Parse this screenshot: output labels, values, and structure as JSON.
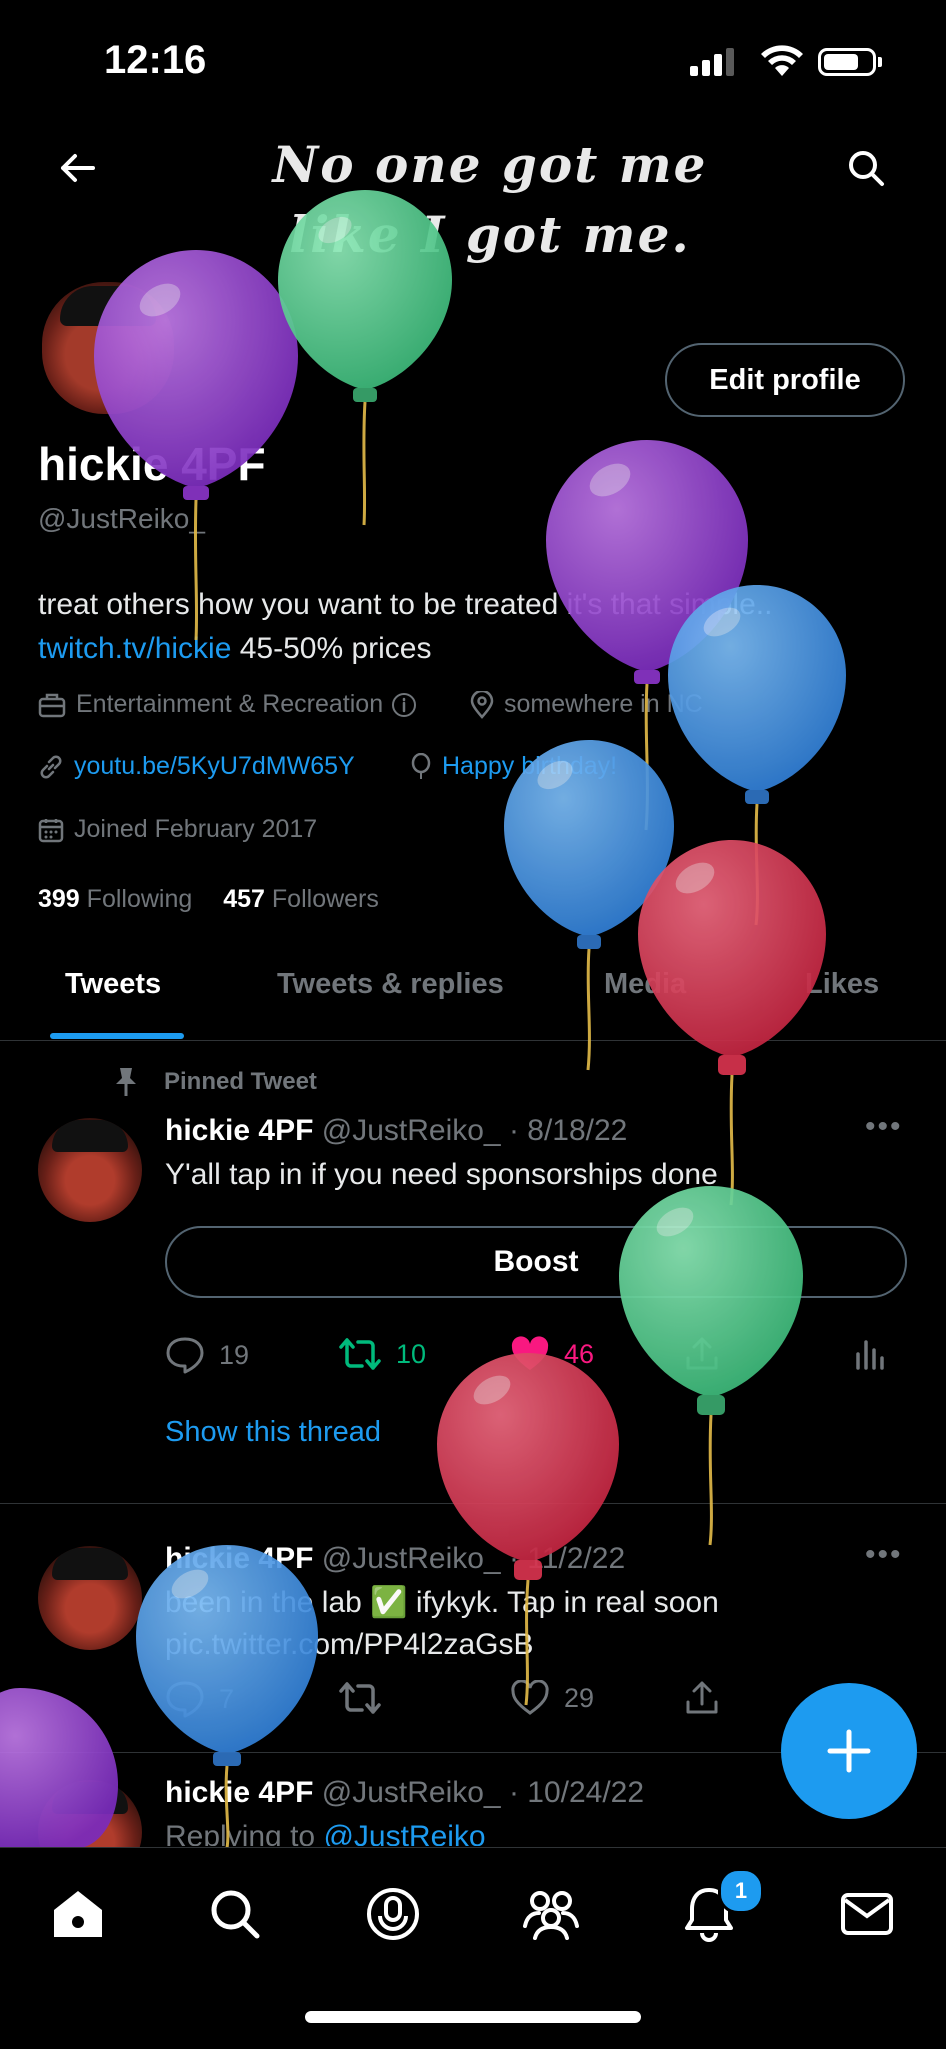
{
  "status": {
    "time": "12:16"
  },
  "banner": {
    "text": "No one got me\nlike I got me."
  },
  "profile": {
    "edit_label": "Edit profile",
    "name": "hickie 4PF",
    "handle": "@JustReiko_",
    "bio_line1": "treat others how you want to be treated it's that simple..",
    "bio_link": "twitch.tv/hickie",
    "bio_rest": " 45-50% prices",
    "category": "Entertainment & Recreation",
    "location": "somewhere in NC",
    "website": "youtu.be/5KyU7dMW65Y",
    "birthday": "Happy birthday!",
    "joined": "Joined February 2017",
    "following_count": "399",
    "following_label": "Following",
    "followers_count": "457",
    "followers_label": "Followers"
  },
  "tabs": [
    {
      "label": "Tweets"
    },
    {
      "label": "Tweets & replies"
    },
    {
      "label": "Media"
    },
    {
      "label": "Likes"
    }
  ],
  "tweets": [
    {
      "pinned_label": "Pinned Tweet",
      "name": "hickie 4PF",
      "meta": "@JustReiko_ · 8/18/22",
      "text": "Y'all tap in if you need sponsorships done",
      "boost_label": "Boost",
      "replies": "19",
      "retweets": "10",
      "likes": "46",
      "show_thread": "Show this thread"
    },
    {
      "name": "hickie 4PF",
      "meta": "@JustReiko_ · 11/2/22",
      "text": "been in the lab ✅ ifykyk. Tap in real soon",
      "link": "pic.twitter.com/PP4l2zaGsB",
      "replies": "7",
      "likes": "29"
    },
    {
      "name": "hickie 4PF",
      "meta": "@JustReiko_ · 10/24/22",
      "reply_prefix": "Replying to ",
      "reply_to": "@JustReiko"
    }
  ],
  "notifications_badge": "1",
  "colors": {
    "accent": "#1d9bf0",
    "retweet": "#00ba7c",
    "like": "#f91880",
    "balloon_purple": "#8e3ad0",
    "balloon_green": "#4fcf8f",
    "balloon_blue": "#3d8fe0",
    "balloon_red": "#d8334f"
  }
}
